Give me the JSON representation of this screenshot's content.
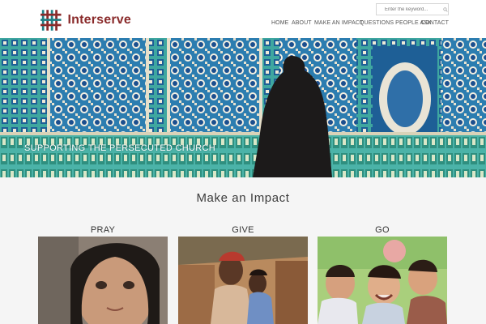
{
  "brand": {
    "name": "Interserve",
    "color": "#8a2b2b"
  },
  "search": {
    "placeholder": "Enter the keyword..."
  },
  "nav": {
    "items": [
      {
        "label": "HOME"
      },
      {
        "label": "ABOUT"
      },
      {
        "label": "MAKE AN IMPACT"
      },
      {
        "label": "QUESTIONS PEOPLE ASK"
      },
      {
        "label": "CONTACT"
      }
    ]
  },
  "hero": {
    "caption": "SUPPORTING THE PERSECUTED CHURCH"
  },
  "section": {
    "title": "Make an Impact",
    "cards": [
      {
        "label": "PRAY"
      },
      {
        "label": "GIVE"
      },
      {
        "label": "GO"
      }
    ]
  }
}
